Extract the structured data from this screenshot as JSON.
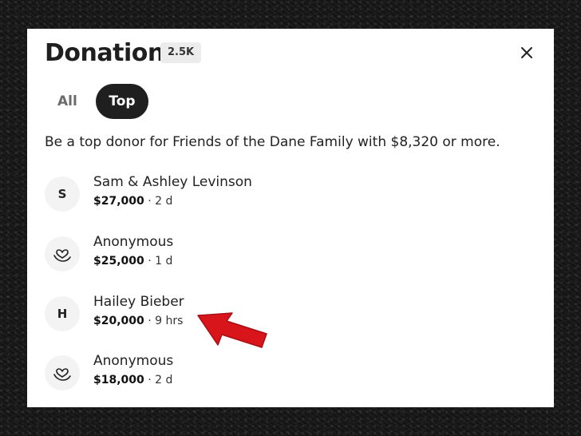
{
  "modal": {
    "title": "Donations",
    "count": "2.5K"
  },
  "tabs": [
    {
      "label": "All",
      "selected": false
    },
    {
      "label": "Top",
      "selected": true
    }
  ],
  "notice": "Be a top donor for Friends of the Dane Family with $8,320 or more.",
  "donors": [
    {
      "initial": "S",
      "icon": "",
      "name": "Sam & Ashley Levinson",
      "amount": "$27,000",
      "time": "2 d"
    },
    {
      "initial": "",
      "icon": "heart-hand-icon",
      "name": "Anonymous",
      "amount": "$25,000",
      "time": "1 d"
    },
    {
      "initial": "H",
      "icon": "",
      "name": "Hailey Bieber",
      "amount": "$20,000",
      "time": "9 hrs"
    },
    {
      "initial": "",
      "icon": "heart-hand-icon",
      "name": "Anonymous",
      "amount": "$18,000",
      "time": "2 d"
    }
  ],
  "colors": {
    "arrow": "#d7151b",
    "tab_selected_bg": "#1f1f1f",
    "badge_bg": "#ececec"
  },
  "icons": {
    "close": "close-icon",
    "annotation": "red-arrow-icon"
  }
}
